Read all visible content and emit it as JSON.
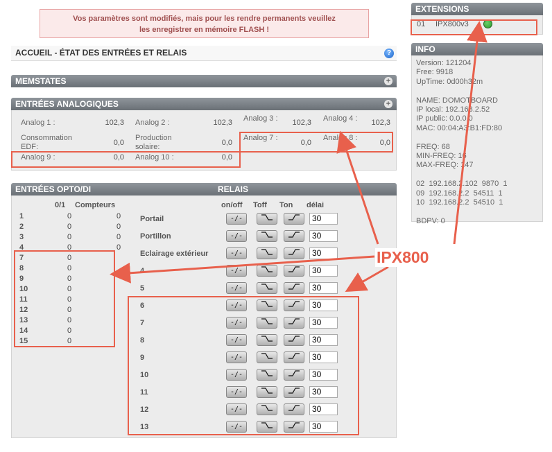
{
  "notice": {
    "line1": "Vos paramètres sont modifiés, mais pour les rendre permanents veuillez",
    "line2": "les enregistrer en mémoire FLASH !"
  },
  "page_title": "ACCUEIL - ÉTAT DES ENTRÉES ET RELAIS",
  "memstates": {
    "title": "MEMSTATES"
  },
  "analog": {
    "title": "ENTRÉES ANALOGIQUES",
    "items": [
      {
        "label": "Analog 1 :",
        "value": "102,3"
      },
      {
        "label": "Analog 2 :",
        "value": "102,3"
      },
      {
        "label": "Analog 3 :",
        "value": "102,3"
      },
      {
        "label": "Analog 4 :",
        "value": "102,3"
      },
      {
        "label": "Consommation EDF:",
        "value": "0,0"
      },
      {
        "label": "Production solaire:",
        "value": "0,0"
      },
      {
        "label": "Analog 7 :",
        "value": "0,0"
      },
      {
        "label": "Analog 8 :",
        "value": "0,0"
      },
      {
        "label": "Analog 9 :",
        "value": "0,0"
      },
      {
        "label": "Analog 10 :",
        "value": "0,0"
      }
    ]
  },
  "opto": {
    "title": "ENTRÉES OPTO/DI",
    "col_state": "0/1",
    "col_counters": "Compteurs",
    "rows": [
      {
        "n": "1",
        "v": "0",
        "c": "0"
      },
      {
        "n": "2",
        "v": "0",
        "c": "0"
      },
      {
        "n": "3",
        "v": "0",
        "c": "0"
      },
      {
        "n": "4",
        "v": "0",
        "c": "0"
      },
      {
        "n": "7",
        "v": "0",
        "c": ""
      },
      {
        "n": "8",
        "v": "0",
        "c": ""
      },
      {
        "n": "9",
        "v": "0",
        "c": ""
      },
      {
        "n": "10",
        "v": "0",
        "c": ""
      },
      {
        "n": "11",
        "v": "0",
        "c": ""
      },
      {
        "n": "12",
        "v": "0",
        "c": ""
      },
      {
        "n": "13",
        "v": "0",
        "c": ""
      },
      {
        "n": "14",
        "v": "0",
        "c": ""
      },
      {
        "n": "15",
        "v": "0",
        "c": ""
      }
    ]
  },
  "relais": {
    "title": "RELAIS",
    "col_onoff": "on/off",
    "col_toff": "Toff",
    "col_ton": "Ton",
    "col_delay": "délai",
    "toggle_label": "-/-",
    "rows": [
      {
        "name": "Portail",
        "delay": "30"
      },
      {
        "name": "Portillon",
        "delay": "30"
      },
      {
        "name": "Eclairage extérieur",
        "delay": "30"
      },
      {
        "name": "4",
        "delay": "30"
      },
      {
        "name": "5",
        "delay": "30"
      },
      {
        "name": "6",
        "delay": "30"
      },
      {
        "name": "7",
        "delay": "30"
      },
      {
        "name": "8",
        "delay": "30"
      },
      {
        "name": "9",
        "delay": "30"
      },
      {
        "name": "10",
        "delay": "30"
      },
      {
        "name": "11",
        "delay": "30"
      },
      {
        "name": "12",
        "delay": "30"
      },
      {
        "name": "13",
        "delay": "30"
      }
    ]
  },
  "extensions": {
    "title": "EXTENSIONS",
    "items": [
      {
        "id": "01",
        "name": "IPX800v3",
        "status_color": "#2e9a2e"
      }
    ]
  },
  "info": {
    "title": "INFO",
    "lines": [
      "Version: 121204",
      "Free: 9918",
      "UpTime: 0d00h32m",
      "",
      "NAME: DOMOTBOARD",
      "IP local: 192.168.2.52",
      "IP public: 0.0.0.0",
      "MAC: 00:04:A3:B1:FD:80",
      "",
      "FREQ: 68",
      "MIN-FREQ: 16",
      "MAX-FREQ: 147",
      "",
      "02  192.168.2.102  9870  1",
      "09  192.168.2.2  54511  1",
      "10  192.168.2.2  54510  1",
      "",
      "BDPV: 0"
    ]
  },
  "annotation": {
    "label": "IPX800",
    "color": "#e8604c"
  }
}
